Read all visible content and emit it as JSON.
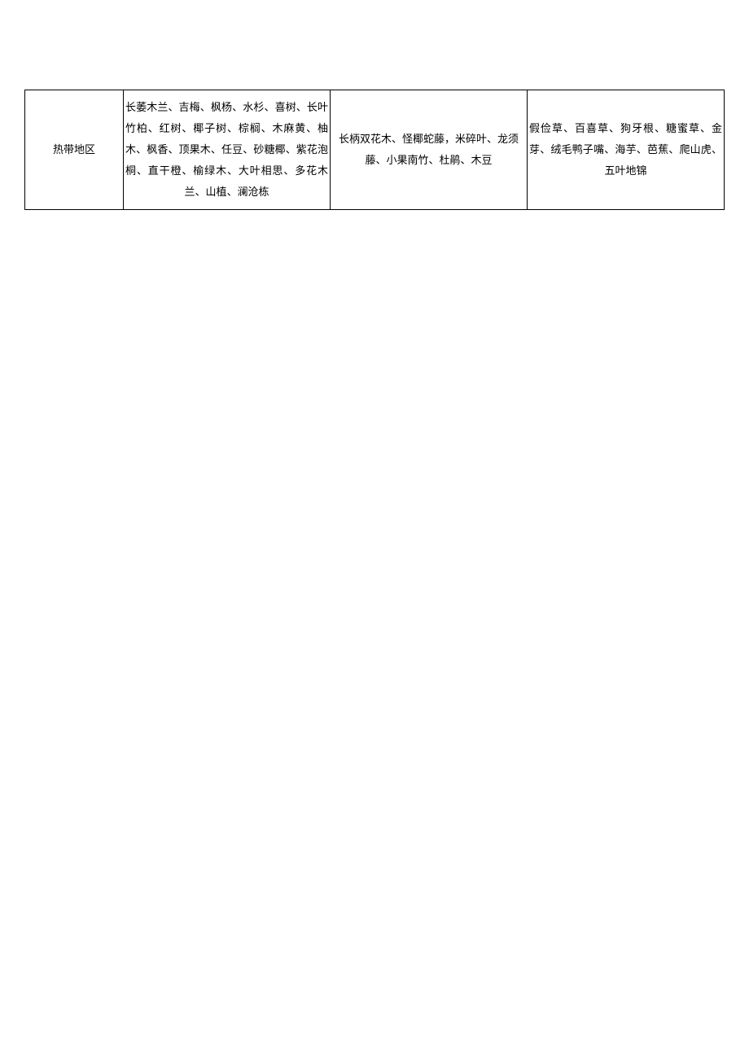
{
  "table": {
    "row": {
      "region": "热带地区",
      "col2": "长萎木兰、吉梅、枫杨、水杉、喜树、长叶竹柏、红树、椰子树、棕榈、木麻黄、柚木、枫香、顶果木、任豆、砂糖椰、紫花泡桐、直干橙、榆绿木、大叶相思、多花木兰、山植、澜沧栋",
      "col3": "长柄双花木、怪椰蛇藤，米碎叶、龙须藤、小果南竹、杜鹃、木豆",
      "col4": "假俭草、百喜草、狗牙根、糖蜜草、金芽、绒毛鸭子嘴、海芋、芭蕉、爬山虎、五叶地锦"
    }
  }
}
